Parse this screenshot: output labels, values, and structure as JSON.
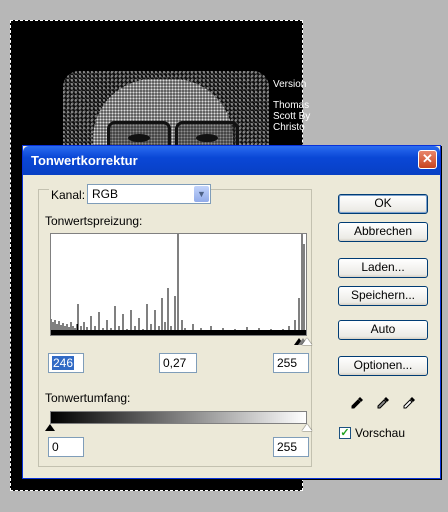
{
  "document": {
    "credits": [
      "Version",
      "",
      "Thomas",
      "Scott By",
      "Christo"
    ]
  },
  "dialog": {
    "title": "Tonwertkorrektur",
    "close_glyph": "✕",
    "channel_label": "Kanal:",
    "channel_value": "RGB",
    "input_levels_label": "Tonwertspreizung:",
    "input_black": "246",
    "input_gamma": "0,27",
    "input_white": "255",
    "output_levels_label": "Tonwertumfang:",
    "output_black": "0",
    "output_white": "255",
    "buttons": {
      "ok": "OK",
      "cancel": "Abbrechen",
      "load": "Laden...",
      "save": "Speichern...",
      "auto": "Auto",
      "options": "Optionen..."
    },
    "preview_label": "Vorschau",
    "preview_checked": true,
    "icons": [
      "black-eyedropper-icon",
      "gray-eyedropper-icon",
      "white-eyedropper-icon"
    ]
  }
}
